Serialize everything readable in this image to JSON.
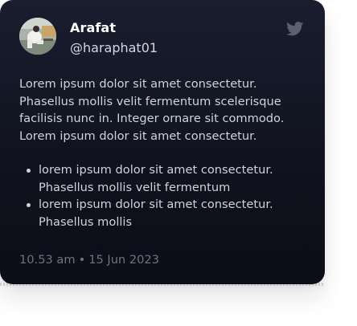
{
  "tweet": {
    "author_name": "Arafat",
    "author_handle": "@haraphat01",
    "paragraph": "Lorem ipsum dolor sit amet consectetur. Phasellus mollis velit fermentum scelerisque facilisis nunc in. Integer ornare sit commodo. Lorem ipsum dolor sit amet consectetur.",
    "bullets": [
      "lorem ipsum dolor sit amet consectetur. Phasellus mollis velit fermentum",
      "lorem ipsum dolor sit amet consectetur. Phasellus mollis"
    ],
    "time": "10.53 am",
    "separator": "•",
    "date": "15 Jun 2023"
  },
  "icons": {
    "brand": "twitter-bird-icon",
    "avatar": "avatar"
  },
  "colors": {
    "card_top": "#1a1d2e",
    "card_bottom": "#0b0d17",
    "text_primary": "#ffffff",
    "text_body": "#d0d3dc",
    "text_muted": "#6e7384",
    "bird": "#5b6070"
  }
}
